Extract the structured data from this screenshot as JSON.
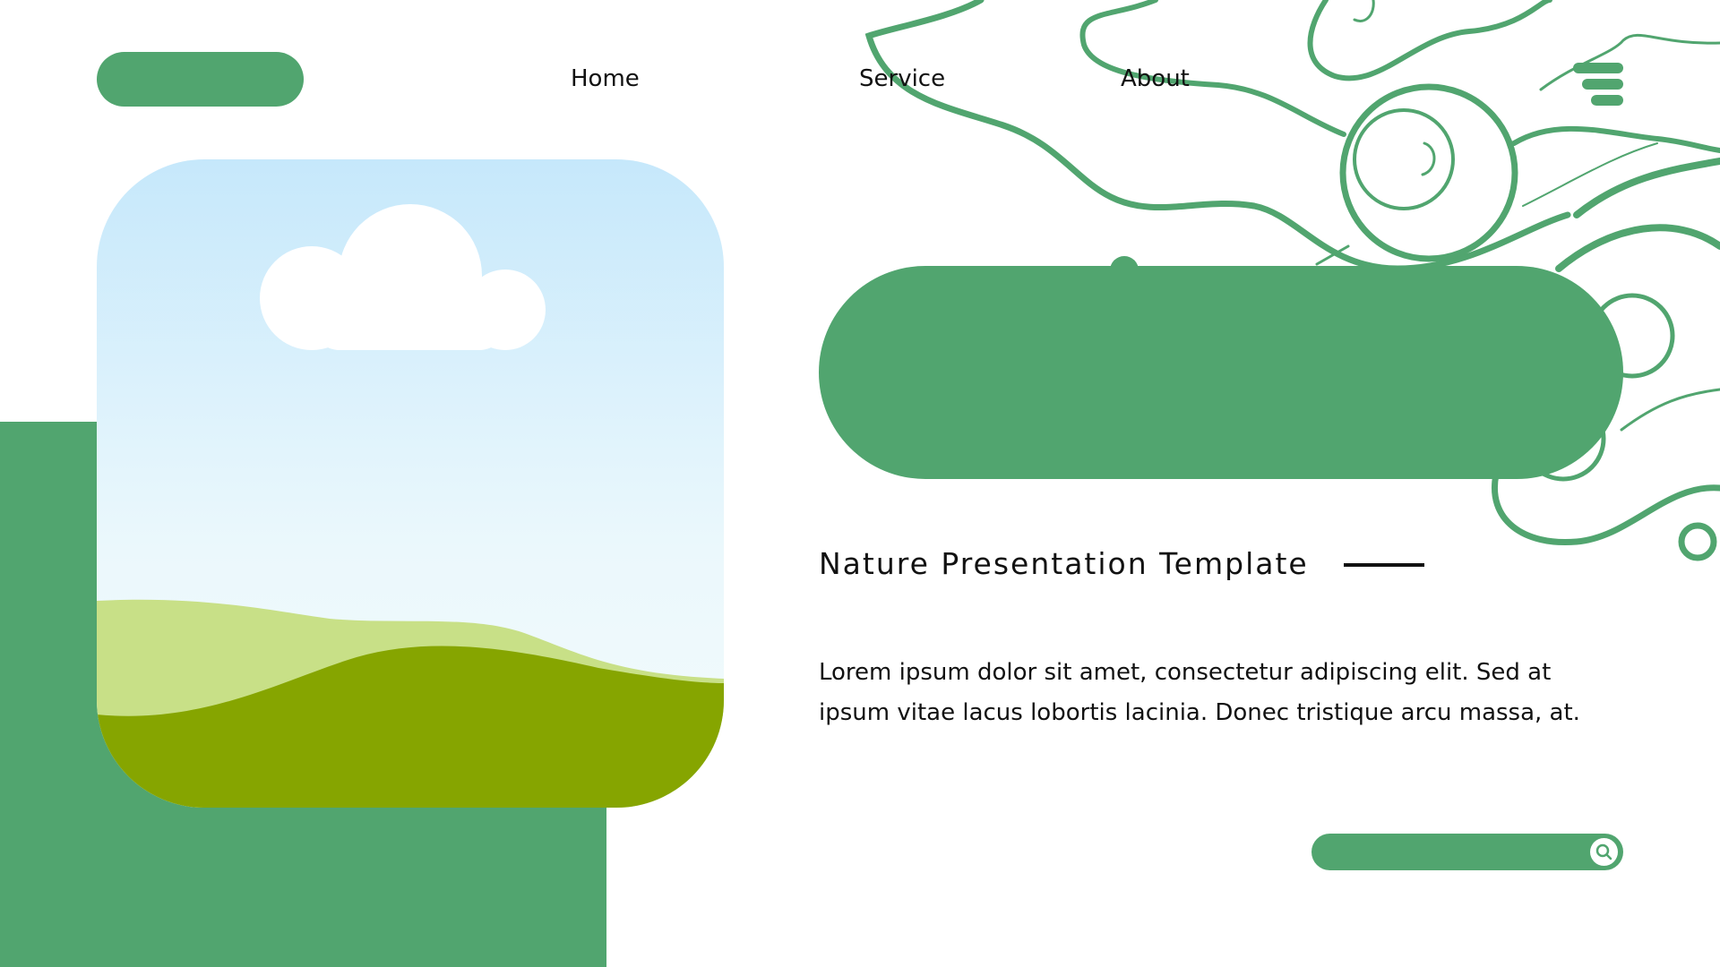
{
  "nav": {
    "items": [
      {
        "label": "Home"
      },
      {
        "label": "Service"
      },
      {
        "label": "About"
      }
    ],
    "menu_icon": "hamburger-menu-icon"
  },
  "hero": {
    "subtitle": "Nature Presentation Template",
    "body": "Lorem ipsum dolor sit amet, consectetur adipiscing elit. Sed at ipsum vitae lacus lobortis lacinia. Donec tristique arcu massa, at."
  },
  "search": {
    "icon": "search-icon"
  },
  "colors": {
    "accent_green": "#51a56f",
    "sky_top": "#c6e8fb",
    "sky_bottom": "#f3fbfd",
    "hill_light": "#c8e087",
    "hill_dark": "#86a500",
    "text": "#111111"
  }
}
